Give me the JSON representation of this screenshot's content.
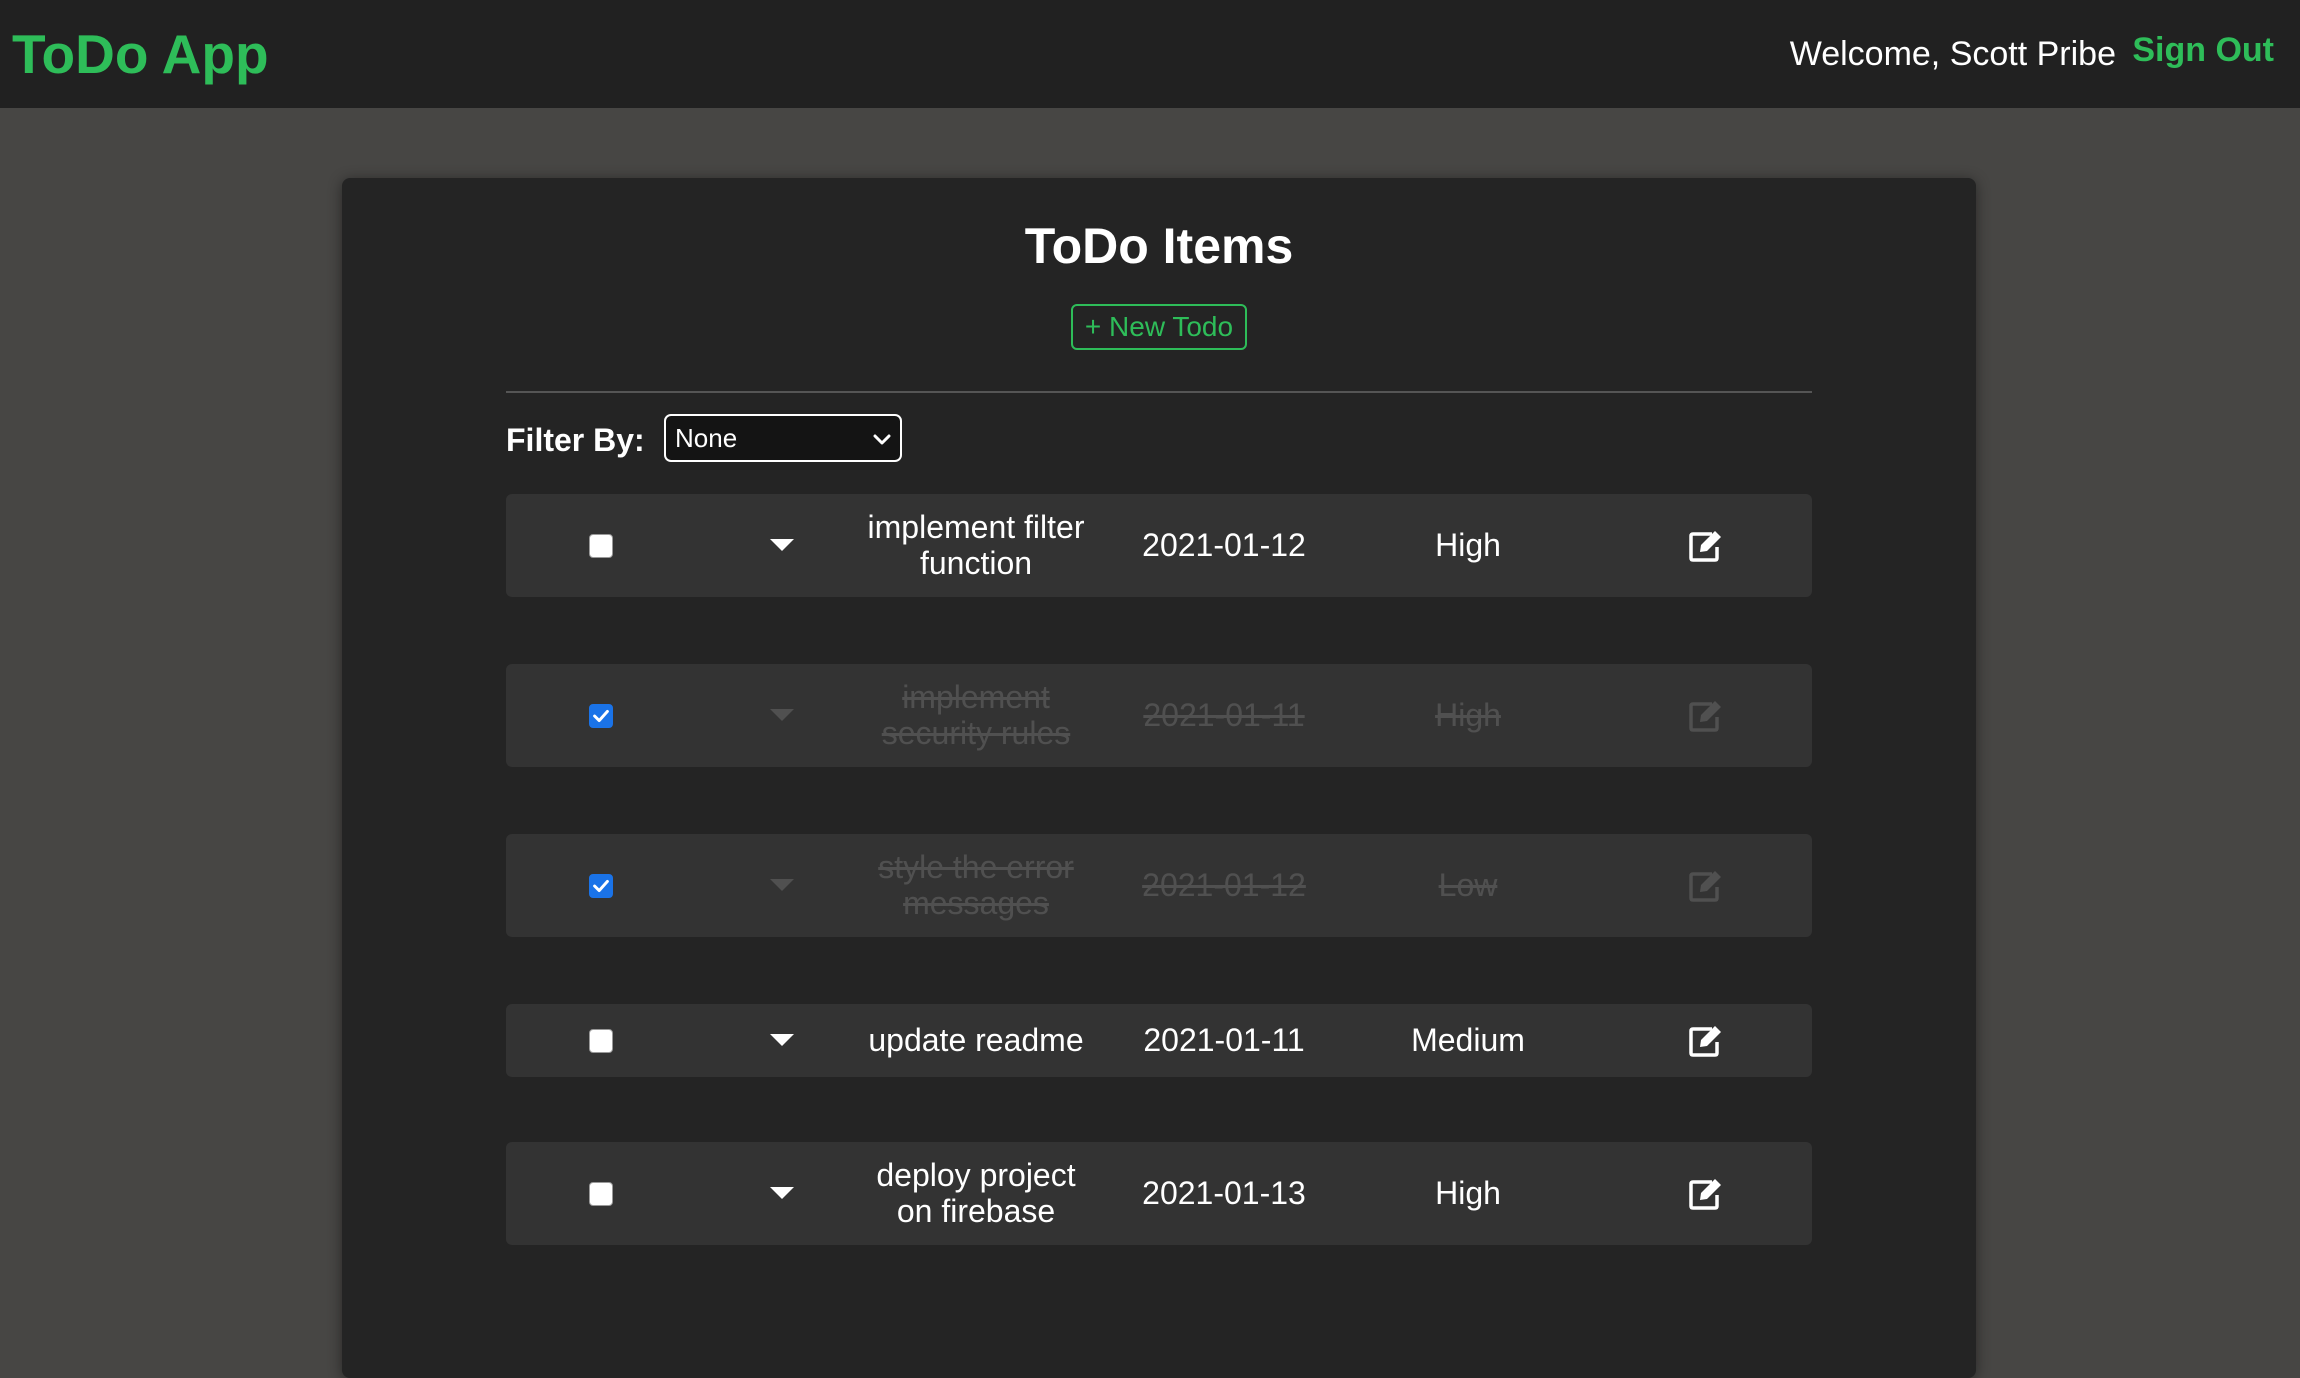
{
  "navbar": {
    "brand": "ToDo App",
    "welcome": "Welcome, Scott Pribe",
    "sign_out": "Sign Out"
  },
  "main": {
    "title": "ToDo Items",
    "new_todo_label": "+ New Todo",
    "filter": {
      "label": "Filter By:",
      "selected": "None"
    },
    "todos": [
      {
        "name": "implement filter function",
        "date": "2021-01-12",
        "priority": "High",
        "completed": false
      },
      {
        "name": "implement security rules",
        "date": "2021-01-11",
        "priority": "High",
        "completed": true
      },
      {
        "name": "style the error messages",
        "date": "2021-01-12",
        "priority": "Low",
        "completed": true
      },
      {
        "name": "update readme",
        "date": "2021-01-11",
        "priority": "Medium",
        "completed": false
      },
      {
        "name": "deploy project on firebase",
        "date": "2021-01-13",
        "priority": "High",
        "completed": false
      }
    ]
  },
  "colors": {
    "brand": "#2ebd59",
    "page_bg": "#474644",
    "navbar_bg": "#212121",
    "card_bg": "#242424",
    "row_bg": "#333333",
    "checkbox_checked": "#1a73e8"
  },
  "icons": {
    "select_chevron": "chevron-down-icon",
    "row_expand": "caret-down-icon",
    "row_edit": "edit-icon",
    "checkbox_check": "check-icon"
  }
}
